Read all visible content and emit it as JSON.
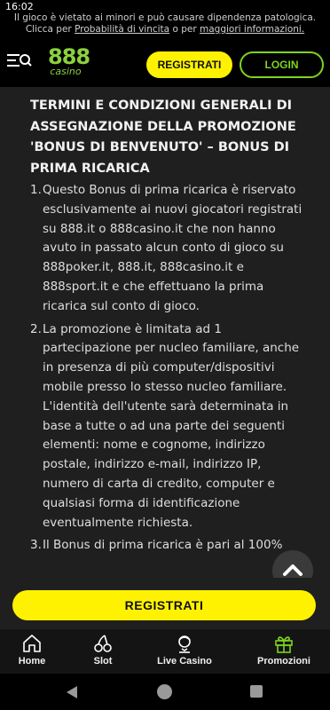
{
  "status_bar": {
    "time": "16:02"
  },
  "disclaimer": {
    "line1": "Il gioco è vietato ai minori e può causare dipendenza patologica.",
    "line2_prefix": "Clicca per ",
    "link1": "Probabilità di vincita",
    "line2_middle": " o per ",
    "link2": "maggiori informazioni."
  },
  "header": {
    "logo_main": "888",
    "logo_sub": "casino",
    "register_label": "REGISTRATI",
    "login_label": "LOGIN"
  },
  "terms": {
    "title": "TERMINI E CONDIZIONI GENERALI DI ASSEGNAZIONE DELLA PROMOZIONE 'BONUS DI BENVENUTO' – BONUS DI PRIMA RICARICA",
    "items": [
      {
        "number": "1.",
        "text": "Questo Bonus di prima ricarica è riservato esclusivamente ai nuovi giocatori registrati su 888.it o 888casino.it che non hanno avuto in passato alcun conto di gioco su 888poker.it, 888.it, 888casino.it e 888sport.it e che effettuano la prima ricarica sul conto di gioco."
      },
      {
        "number": "2.",
        "text": "La promozione è limitata ad 1 partecipazione per nucleo familiare, anche in presenza di più computer/dispositivi mobile presso lo stesso nucleo familiare. L'identità dell'utente sarà determinata in base a tutte o ad una parte dei seguenti elementi: nome e cognome, indirizzo postale, indirizzo e-mail, indirizzo IP, numero di carta di credito, computer e qualsiasi forma di identificazione eventualmente richiesta."
      },
      {
        "number": "3.",
        "text": "Il Bonus di prima ricarica è pari al 100%"
      }
    ]
  },
  "cta": {
    "register_label": "REGISTRATI"
  },
  "bottom_nav": {
    "items": [
      {
        "label": "Home",
        "icon": "home-icon"
      },
      {
        "label": "Slot",
        "icon": "cherries-icon"
      },
      {
        "label": "Live Casino",
        "icon": "dealer-icon"
      },
      {
        "label": "Promozioni",
        "icon": "gift-icon"
      }
    ],
    "active_index": 3
  },
  "colors": {
    "brand_green": "#7ed321",
    "cta_yellow": "#fff200",
    "content_bg": "#1f1f1f"
  }
}
